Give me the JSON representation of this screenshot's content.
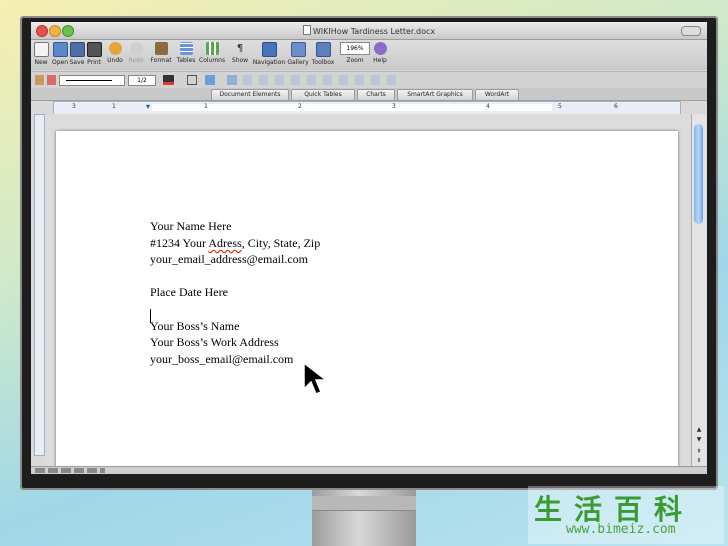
{
  "window": {
    "title": "WIKIHow Tardiness Letter.docx"
  },
  "toolbar": {
    "buttons": [
      {
        "label": "New"
      },
      {
        "label": "Open"
      },
      {
        "label": "Save"
      },
      {
        "label": "Print"
      },
      {
        "label": "Undo"
      },
      {
        "label": "Redo"
      },
      {
        "label": "Format"
      },
      {
        "label": "Tables"
      },
      {
        "label": "Columns"
      },
      {
        "label": "Show"
      },
      {
        "label": "Navigation"
      },
      {
        "label": "Gallery"
      },
      {
        "label": "Toolbox"
      },
      {
        "label": "Zoom"
      },
      {
        "label": "Help"
      }
    ],
    "zoom_value": "196%",
    "line_weight_value": "1/2"
  },
  "ribbon": {
    "tabs": [
      "Document Elements",
      "Quick Tables",
      "Charts",
      "SmartArt Graphics",
      "WordArt"
    ]
  },
  "ruler": {
    "labels": [
      "3",
      "1",
      "1",
      "2",
      "3",
      "4",
      "5",
      "6"
    ]
  },
  "document": {
    "lines": [
      "Your Name Here",
      "#1234 Your Adress, City, State, Zip",
      "your_email_address@email.com",
      "",
      "Place Date Here",
      "",
      "Your Boss’s Name",
      "Your Boss’s Work Address",
      "your_boss_email@email.com"
    ],
    "address_prefix": "#1234 Your ",
    "address_misspelled": "Adress",
    "address_suffix": ", City, State, Zip"
  },
  "watermark": {
    "chinese": "生活百科",
    "url": "www.bimeiz.com"
  }
}
